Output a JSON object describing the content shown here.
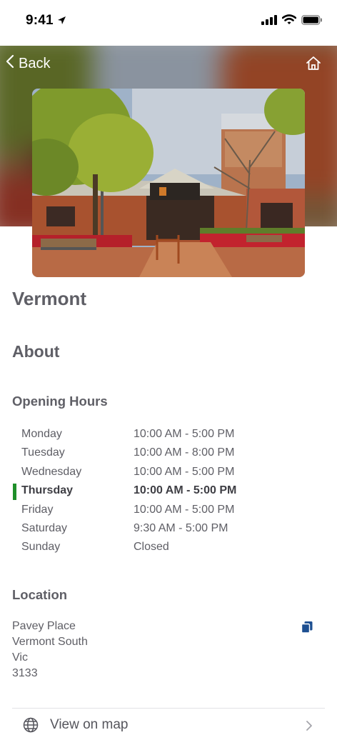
{
  "status_bar": {
    "time": "9:41"
  },
  "nav": {
    "back_label": "Back"
  },
  "library": {
    "name": "Vermont"
  },
  "about": {
    "heading": "About"
  },
  "opening_hours": {
    "heading": "Opening Hours",
    "rows": [
      {
        "day": "Monday",
        "hours": "10:00 AM - 5:00 PM",
        "today": false
      },
      {
        "day": "Tuesday",
        "hours": "10:00 AM - 8:00 PM",
        "today": false
      },
      {
        "day": "Wednesday",
        "hours": "10:00 AM - 5:00 PM",
        "today": false
      },
      {
        "day": "Thursday",
        "hours": "10:00 AM - 5:00 PM",
        "today": true
      },
      {
        "day": "Friday",
        "hours": "10:00 AM - 5:00 PM",
        "today": false
      },
      {
        "day": "Saturday",
        "hours": "9:30 AM - 5:00 PM",
        "today": false
      },
      {
        "day": "Sunday",
        "hours": "Closed",
        "today": false
      }
    ]
  },
  "location": {
    "heading": "Location",
    "address_lines": [
      "Pavey Place",
      "Vermont South",
      "Vic",
      "3133"
    ]
  },
  "map_link": {
    "label": "View on map"
  },
  "colors": {
    "today_marker": "#1f8f2a",
    "copy_icon": "#1d4f91"
  },
  "icons": [
    "location-arrow-icon",
    "cellular-signal-icon",
    "wifi-icon",
    "battery-icon",
    "chevron-left-icon",
    "home-icon",
    "copy-icon",
    "globe-icon",
    "chevron-right-icon"
  ]
}
